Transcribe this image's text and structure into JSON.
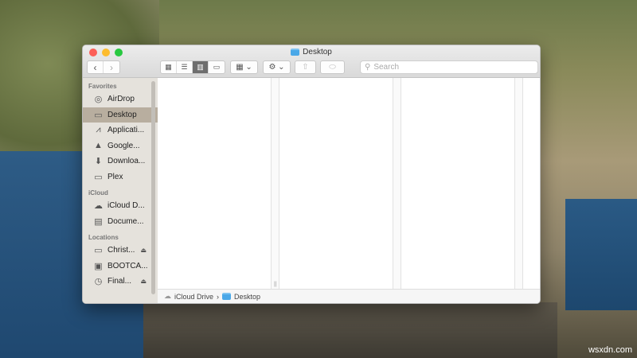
{
  "window": {
    "title": "Desktop"
  },
  "toolbar": {
    "search_placeholder": "Search"
  },
  "sidebar": {
    "favorites_label": "Favorites",
    "favorites": [
      {
        "label": "AirDrop",
        "icon": "airdrop-icon"
      },
      {
        "label": "Desktop",
        "icon": "desktop-icon"
      },
      {
        "label": "Applicati...",
        "icon": "applications-icon"
      },
      {
        "label": "Google...",
        "icon": "google-drive-icon"
      },
      {
        "label": "Downloa...",
        "icon": "downloads-icon"
      },
      {
        "label": "Plex",
        "icon": "folder-icon"
      }
    ],
    "icloud_label": "iCloud",
    "icloud": [
      {
        "label": "iCloud D...",
        "icon": "cloud-icon"
      },
      {
        "label": "Docume...",
        "icon": "documents-icon"
      }
    ],
    "locations_label": "Locations",
    "locations": [
      {
        "label": "Christ...",
        "icon": "disk-icon"
      },
      {
        "label": "BOOTCA...",
        "icon": "disk-icon"
      },
      {
        "label": "Final...",
        "icon": "time-machine-icon"
      }
    ]
  },
  "pathbar": {
    "items": [
      "iCloud Drive",
      "Desktop"
    ],
    "separator": "›"
  },
  "watermark": "wsxdn.com"
}
